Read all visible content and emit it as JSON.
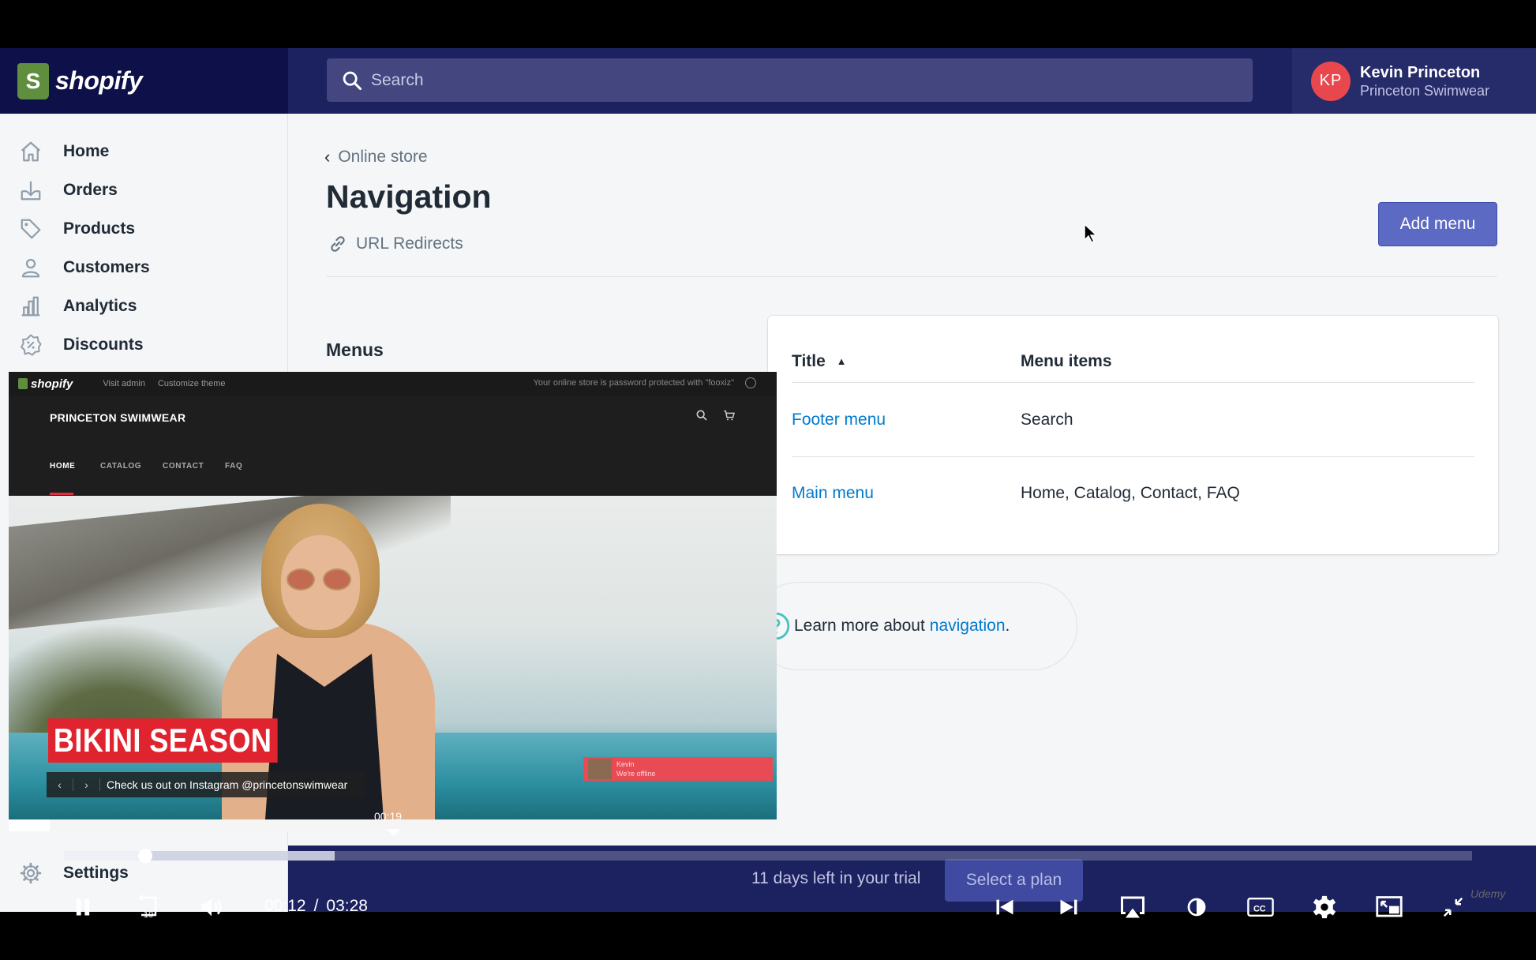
{
  "topbar": {
    "logo_text": "shopify",
    "logo_glyph": "S",
    "search_placeholder": "Search",
    "user": {
      "initials": "KP",
      "name": "Kevin Princeton",
      "store": "Princeton Swimwear"
    }
  },
  "sidebar": {
    "items": [
      {
        "label": "Home",
        "icon": "home-icon"
      },
      {
        "label": "Orders",
        "icon": "orders-icon"
      },
      {
        "label": "Products",
        "icon": "tag-icon"
      },
      {
        "label": "Customers",
        "icon": "person-icon"
      },
      {
        "label": "Analytics",
        "icon": "bar-chart-icon"
      },
      {
        "label": "Discounts",
        "icon": "discount-icon"
      }
    ],
    "settings_label": "Settings"
  },
  "main": {
    "breadcrumb": "Online store",
    "title": "Navigation",
    "redirects_link": "URL Redirects",
    "add_menu_label": "Add menu",
    "menus_label": "Menus",
    "table": {
      "headers": [
        "Title",
        "Menu items"
      ],
      "rows": [
        {
          "title": "Footer menu",
          "items": "Search"
        },
        {
          "title": "Main menu",
          "items": "Home, Catalog, Contact, FAQ"
        }
      ]
    },
    "learn": {
      "prefix": "Learn more about",
      "link": "navigation",
      "suffix": "."
    }
  },
  "trial": {
    "text": "11 days left in your trial",
    "button": "Select a plan"
  },
  "preview": {
    "admin_logo": "shopify",
    "visit_admin": "Visit admin",
    "customize_theme": "Customize theme",
    "password_notice": "Your online store is password protected with \"fooxiz\"",
    "brand": "PRINCETON SWIMWEAR",
    "nav": [
      "HOME",
      "CATALOG",
      "CONTACT",
      "FAQ"
    ],
    "banner": "BIKINI SEASON",
    "caption": "Check us out on Instagram @princetonswimwear",
    "chat_name": "Kevin",
    "chat_status": "We're offline"
  },
  "player": {
    "hover_time": "00:19",
    "current_time": "00:12",
    "separator": "/",
    "duration": "03:28",
    "played_fraction": 0.058,
    "buffered_fraction": 0.192,
    "rewind_label": "10",
    "cc_label": "CC",
    "brand": "Udemy"
  },
  "colors": {
    "topbar": "#1c2260",
    "accent_button": "#5c6ac4",
    "link": "#007ace",
    "avatar": "#e8474d",
    "banner": "#e0242f"
  }
}
